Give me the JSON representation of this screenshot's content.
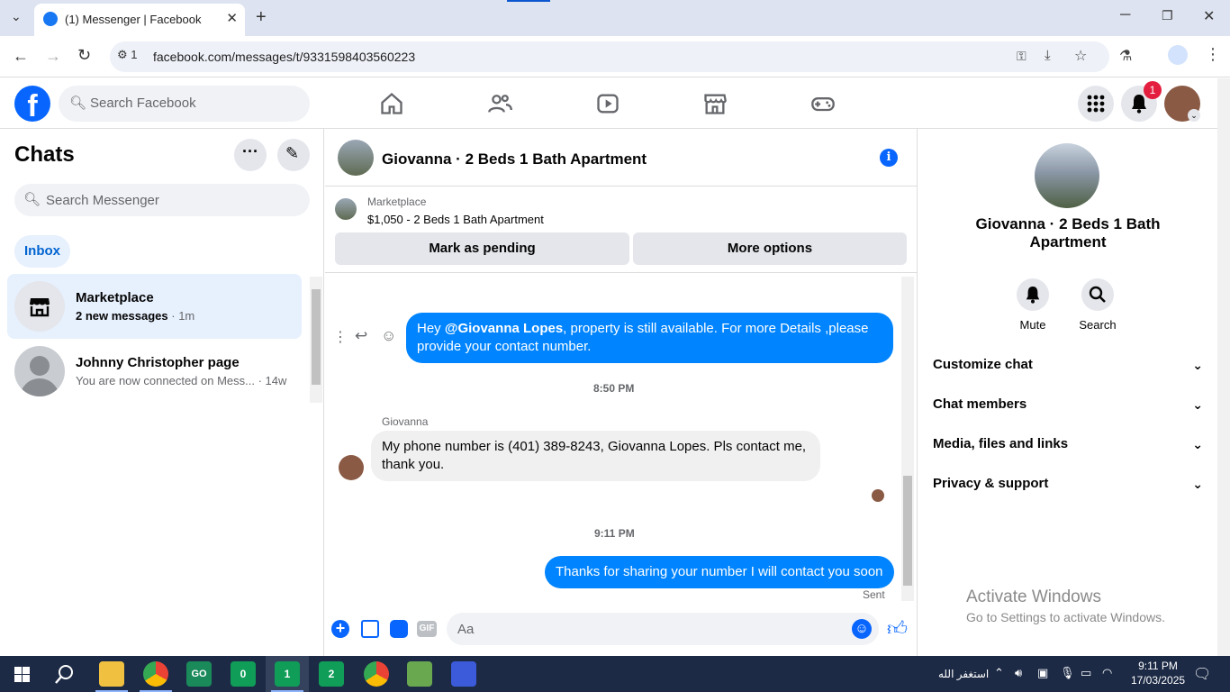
{
  "browser": {
    "tab_title": "(1) Messenger | Facebook",
    "url": "facebook.com/messages/t/9331598403560223",
    "site_info_count": "1"
  },
  "fb": {
    "logo_letter": "f",
    "search_placeholder": "Search Facebook",
    "notification_count": "1"
  },
  "sidebar": {
    "title": "Chats",
    "search_placeholder": "Search Messenger",
    "inbox_label": "Inbox",
    "chats": [
      {
        "name": "Marketplace",
        "preview": "2 new messages",
        "time": "· 1m"
      },
      {
        "name": "Johnny Christopher page",
        "preview": "You are now connected on Mess...",
        "time": " · 14w"
      }
    ]
  },
  "conversation": {
    "title": "Giovanna · 2 Beds 1 Bath Apartment",
    "marketplace_label": "Marketplace",
    "listing": "$1,050 - 2 Beds 1 Bath Apartment",
    "mark_pending_label": "Mark as pending",
    "more_options_label": "More options",
    "messages": {
      "out1_prefix": "Hey ",
      "out1_mention": "@Giovanna Lopes",
      "out1_rest": ", property is still available. For more Details ,please provide your contact number.",
      "time1": "8:50 PM",
      "sender_name": "Giovanna",
      "in1": "My phone number is (401) 389-8243, Giovanna Lopes. Pls contact me, thank you.",
      "time2": "9:11 PM",
      "out2": "Thanks for sharing your number I will contact you soon",
      "status": "Sent"
    },
    "composer_placeholder": "Aa",
    "gif_label": "GIF"
  },
  "details": {
    "name": "Giovanna · 2 Beds 1 Bath Apartment",
    "mute_label": "Mute",
    "search_label": "Search",
    "sections": [
      "Customize chat",
      "Chat members",
      "Media, files and links",
      "Privacy & support"
    ]
  },
  "watermark": {
    "line1": "Activate Windows",
    "line2": "Go to Settings to activate Windows."
  },
  "taskbar": {
    "app_badges": [
      "0",
      "1",
      "2"
    ],
    "locale_text": "استغفر الله",
    "time": "9:11 PM",
    "date": "17/03/2025"
  },
  "colors": {
    "fb_blue": "#0866ff",
    "bubble_blue": "#0084ff",
    "badge_red": "#e41e3f"
  }
}
